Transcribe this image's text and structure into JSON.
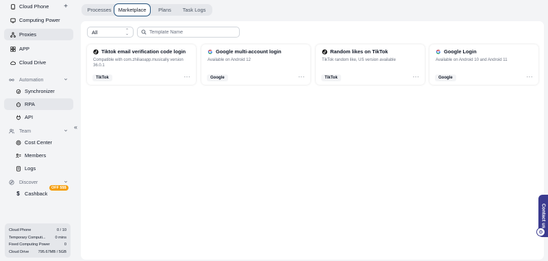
{
  "sidebar": {
    "cloud_phone": "Cloud Phone",
    "computing_power": "Computing Power",
    "proxies": "Proxies",
    "app": "APP",
    "cloud_drive": "Cloud Drive",
    "automation": "Automation",
    "synchronizer": "Synchronizer",
    "rpa": "RPA",
    "api": "API",
    "team": "Team",
    "cost_center": "Cost Center",
    "members": "Members",
    "logs": "Logs",
    "discover": "Discover",
    "cashback": "Cashback",
    "cashback_badge": "OFF $$$"
  },
  "stats": [
    {
      "label": "Cloud Phone",
      "value": "0 / 10"
    },
    {
      "label": "Temporary Computi...",
      "value": "0 mins"
    },
    {
      "label": "Fixed Computing Power",
      "value": "0"
    },
    {
      "label": "Cloud Drive",
      "value": "795.67MB / 5GB"
    }
  ],
  "tabs": {
    "processes": "Processes",
    "marketplace": "Marketplace",
    "plans": "Plans",
    "task_logs": "Task Logs"
  },
  "filter": {
    "select_value": "All",
    "search_placeholder": "Template Name"
  },
  "cards": [
    {
      "title": "Tiktok email verification code login",
      "desc": "Compatible with com.zhiliaoapp.musically version 36.0.1",
      "tag": "TikTok",
      "icon": "tiktok-icon"
    },
    {
      "title": "Google multi-account login",
      "desc": "Available on Android 12",
      "tag": "Google",
      "icon": "google-icon"
    },
    {
      "title": "Random likes on TikTok",
      "desc": "TikTok random like, US version available",
      "tag": "TikTok",
      "icon": "tiktok-icon"
    },
    {
      "title": "Google Login",
      "desc": "Available on Android 10 and Android 11",
      "tag": "Google",
      "icon": "google-icon"
    }
  ],
  "contact": "Contact us",
  "colors": {
    "accent": "#1f4e79",
    "contact_bg": "#3b3b8f",
    "promo": "#f59e0b"
  }
}
